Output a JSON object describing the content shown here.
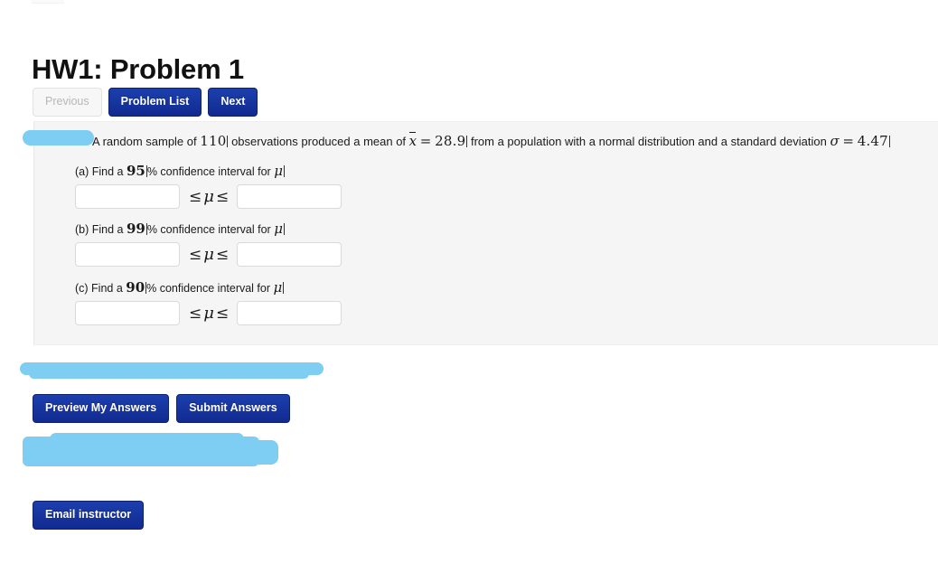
{
  "page": {
    "title": "HW1: Problem 1"
  },
  "nav": {
    "previous_label": "Previous",
    "problem_list_label": "Problem List",
    "next_label": "Next"
  },
  "problem": {
    "text_part1": "A random sample of ",
    "sample_size": "110",
    "text_part2": " observations produced a mean of ",
    "xbar_symbol": "x",
    "equals1": "=",
    "mean_value": "28.9",
    "text_part3": " from a population with a normal distribution and a standard deviation ",
    "sigma_symbol": "σ",
    "equals2": "=",
    "sigma_value": "4.47",
    "parts": [
      {
        "prefix": "(a) Find a ",
        "level": "95",
        "suffix": "% confidence interval for ",
        "mu": "μ",
        "lower_value": "",
        "upper_value": "",
        "inequality_left": "≤",
        "inequality_mu": "μ",
        "inequality_right": "≤"
      },
      {
        "prefix": "(b) Find a ",
        "level": "99",
        "suffix": "% confidence interval for ",
        "mu": "μ",
        "lower_value": "",
        "upper_value": "",
        "inequality_left": "≤",
        "inequality_mu": "μ",
        "inequality_right": "≤"
      },
      {
        "prefix": "(c) Find a ",
        "level": "90",
        "suffix": "% confidence interval for ",
        "mu": "μ",
        "lower_value": "",
        "upper_value": "",
        "inequality_left": "≤",
        "inequality_mu": "μ",
        "inequality_right": "≤"
      }
    ]
  },
  "actions": {
    "preview_label": "Preview My Answers",
    "submit_label": "Submit Answers",
    "email_label": "Email instructor"
  },
  "colors": {
    "button_primary": "#15308f",
    "panel_background": "#f5f5f5",
    "highlighter": "#7ecdf3",
    "disabled_text": "#b7b7b7"
  }
}
